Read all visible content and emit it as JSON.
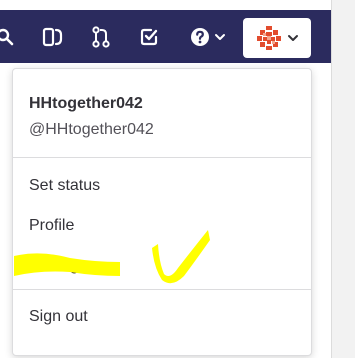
{
  "navbar": {
    "background": "#2b2b5e",
    "icons": [
      "search-icon",
      "merge-requests-icon",
      "git-merge-icon",
      "todo-check-icon",
      "help-icon",
      "chevron-down-icon"
    ]
  },
  "user_menu": {
    "name": "HHtogether042",
    "handle": "@HHtogether042",
    "items": [
      {
        "label": "Set status"
      },
      {
        "label": "Profile"
      },
      {
        "label": "Settings"
      },
      {
        "label": "Sign out"
      }
    ]
  },
  "annotation": {
    "highlight_color": "#ffff00",
    "highlighted_item": "Settings"
  }
}
